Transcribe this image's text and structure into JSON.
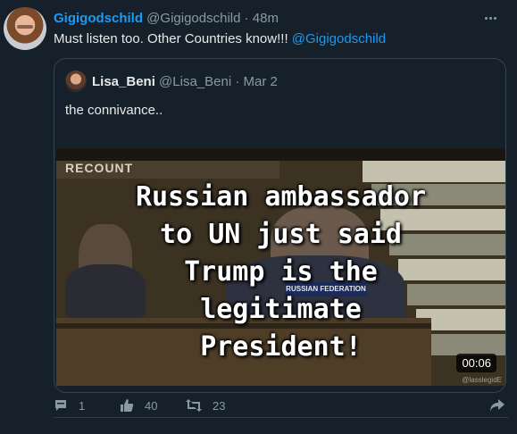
{
  "tweet": {
    "display_name": "Gigigodschild",
    "handle": "@Gigigodschild",
    "separator": "·",
    "time": "48m",
    "text": "Must listen too. Other Countries know!!! ",
    "mention": "@Gigigodschild"
  },
  "quoted_tweet": {
    "display_name": "Lisa_Beni",
    "handle": "@Lisa_Beni",
    "separator": "·",
    "date": "Mar 2",
    "text": "the connivance.."
  },
  "video": {
    "overlay_logo": "RECOUNT",
    "caption_lines": [
      "Russian ambassador",
      "to UN just said",
      "Trump is the",
      "legitimate",
      "President!"
    ],
    "nameplate": "RUSSIAN FEDERATION",
    "duration": "00:06",
    "watermark": "@lasslegidE"
  },
  "actions": {
    "reply_count": "1",
    "like_count": "40",
    "retweet_count": "23"
  },
  "icons": [
    "more-icon",
    "reply-icon",
    "like-icon",
    "retweet-icon",
    "share-icon"
  ],
  "colors": {
    "background": "#15202b",
    "accent": "#1d9bf0",
    "muted_text": "#8b98a5",
    "border": "#38444d"
  }
}
